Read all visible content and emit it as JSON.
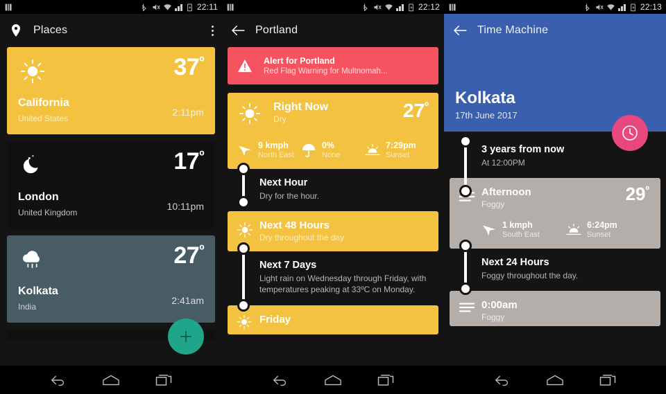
{
  "screens": {
    "places": {
      "status": {
        "time": "22:11",
        "icons": [
          "bluetooth-icon",
          "mute-icon",
          "wifi-icon",
          "signal-icon",
          "battery-icon"
        ]
      },
      "appbar": {
        "title": "Places",
        "leading_icon": "location-pin-icon",
        "overflow_icon": "overflow-menu-icon"
      },
      "cards": [
        {
          "icon": "sun-icon",
          "name": "California",
          "country": "United States",
          "temp": "37",
          "deg": "º",
          "time": "2:11pm",
          "bg": "#f2c240",
          "text": "#ffffff"
        },
        {
          "icon": "moon-icon",
          "name": "London",
          "country": "United Kingdom",
          "temp": "17",
          "deg": "º",
          "time": "10:11pm",
          "bg": "#111111",
          "text": "#ffffff"
        },
        {
          "icon": "rain-cloud-icon",
          "name": "Kolkata",
          "country": "India",
          "temp": "27",
          "deg": "º",
          "time": "2:41am",
          "bg": "#485c66",
          "text": "#ffffff"
        }
      ],
      "fab": {
        "icon": "plus-icon",
        "color": "#1fa58a"
      }
    },
    "forecast": {
      "status": {
        "time": "22:12"
      },
      "appbar": {
        "title": "Portland",
        "leading_icon": "back-arrow-icon"
      },
      "alert": {
        "icon": "warning-triangle-icon",
        "title": "Alert for Portland",
        "subtitle": "Red Flag Warning for Multnomah...",
        "color": "#f4535f"
      },
      "right_now": {
        "icon": "sun-icon",
        "title": "Right Now",
        "subtitle": "Dry",
        "temp": "27",
        "deg": "º",
        "metrics": [
          {
            "icon": "wind-arrow-icon",
            "value": "9 kmph",
            "label": "North East"
          },
          {
            "icon": "umbrella-icon",
            "value": "0%",
            "label": "None"
          },
          {
            "icon": "sunset-icon",
            "value": "7:29pm",
            "label": "Sunset"
          }
        ]
      },
      "timeline": [
        {
          "style": "dark",
          "title": "Next Hour",
          "subtitle": "Dry for the hour."
        },
        {
          "style": "yellow",
          "icon": "sun-icon",
          "title": "Next 48 Hours",
          "subtitle": "Dry throughout the day"
        },
        {
          "style": "dark",
          "title": "Next 7 Days",
          "subtitle": "Light rain on Wednesday through Friday, with temperatures peaking at 33ºC on Monday."
        },
        {
          "style": "yellow",
          "icon": "sun-icon",
          "title": "Friday",
          "subtitle": ""
        }
      ]
    },
    "time_machine": {
      "status": {
        "time": "22:13"
      },
      "appbar": {
        "title": "Time Machine",
        "leading_icon": "back-arrow-icon",
        "color": "#3a5fae"
      },
      "hero": {
        "city": "Kolkata",
        "date": "17th June 2017"
      },
      "fab": {
        "icon": "clock-icon",
        "color": "#e8477f"
      },
      "timeline": [
        {
          "style": "dark",
          "title": "3 years from now",
          "subtitle": "At 12:00PM"
        },
        {
          "style": "card",
          "icon": "fog-icon",
          "title": "Afternoon",
          "subtitle": "Foggy",
          "temp": "29",
          "deg": "º",
          "metrics": [
            {
              "icon": "wind-arrow-icon",
              "value": "1 kmph",
              "label": "South East"
            },
            {
              "icon": "sunset-icon",
              "value": "6:24pm",
              "label": "Sunset"
            }
          ]
        },
        {
          "style": "dark",
          "title": "Next 24 Hours",
          "subtitle": "Foggy throughout the day."
        },
        {
          "style": "card",
          "icon": "fog-icon",
          "title": "0:00am",
          "subtitle": "Foggy"
        }
      ]
    }
  },
  "navbar": {
    "buttons": [
      {
        "icon": "back-nav-icon",
        "label": "Back"
      },
      {
        "icon": "home-nav-icon",
        "label": "Home"
      },
      {
        "icon": "recents-nav-icon",
        "label": "Recents"
      }
    ]
  },
  "colors": {
    "yellow": "#f2c240",
    "slate": "#485c66",
    "blue": "#3a5fae",
    "pink": "#e8477f",
    "green": "#1fa58a",
    "red": "#f4535f",
    "taupe": "#b4aeab"
  }
}
